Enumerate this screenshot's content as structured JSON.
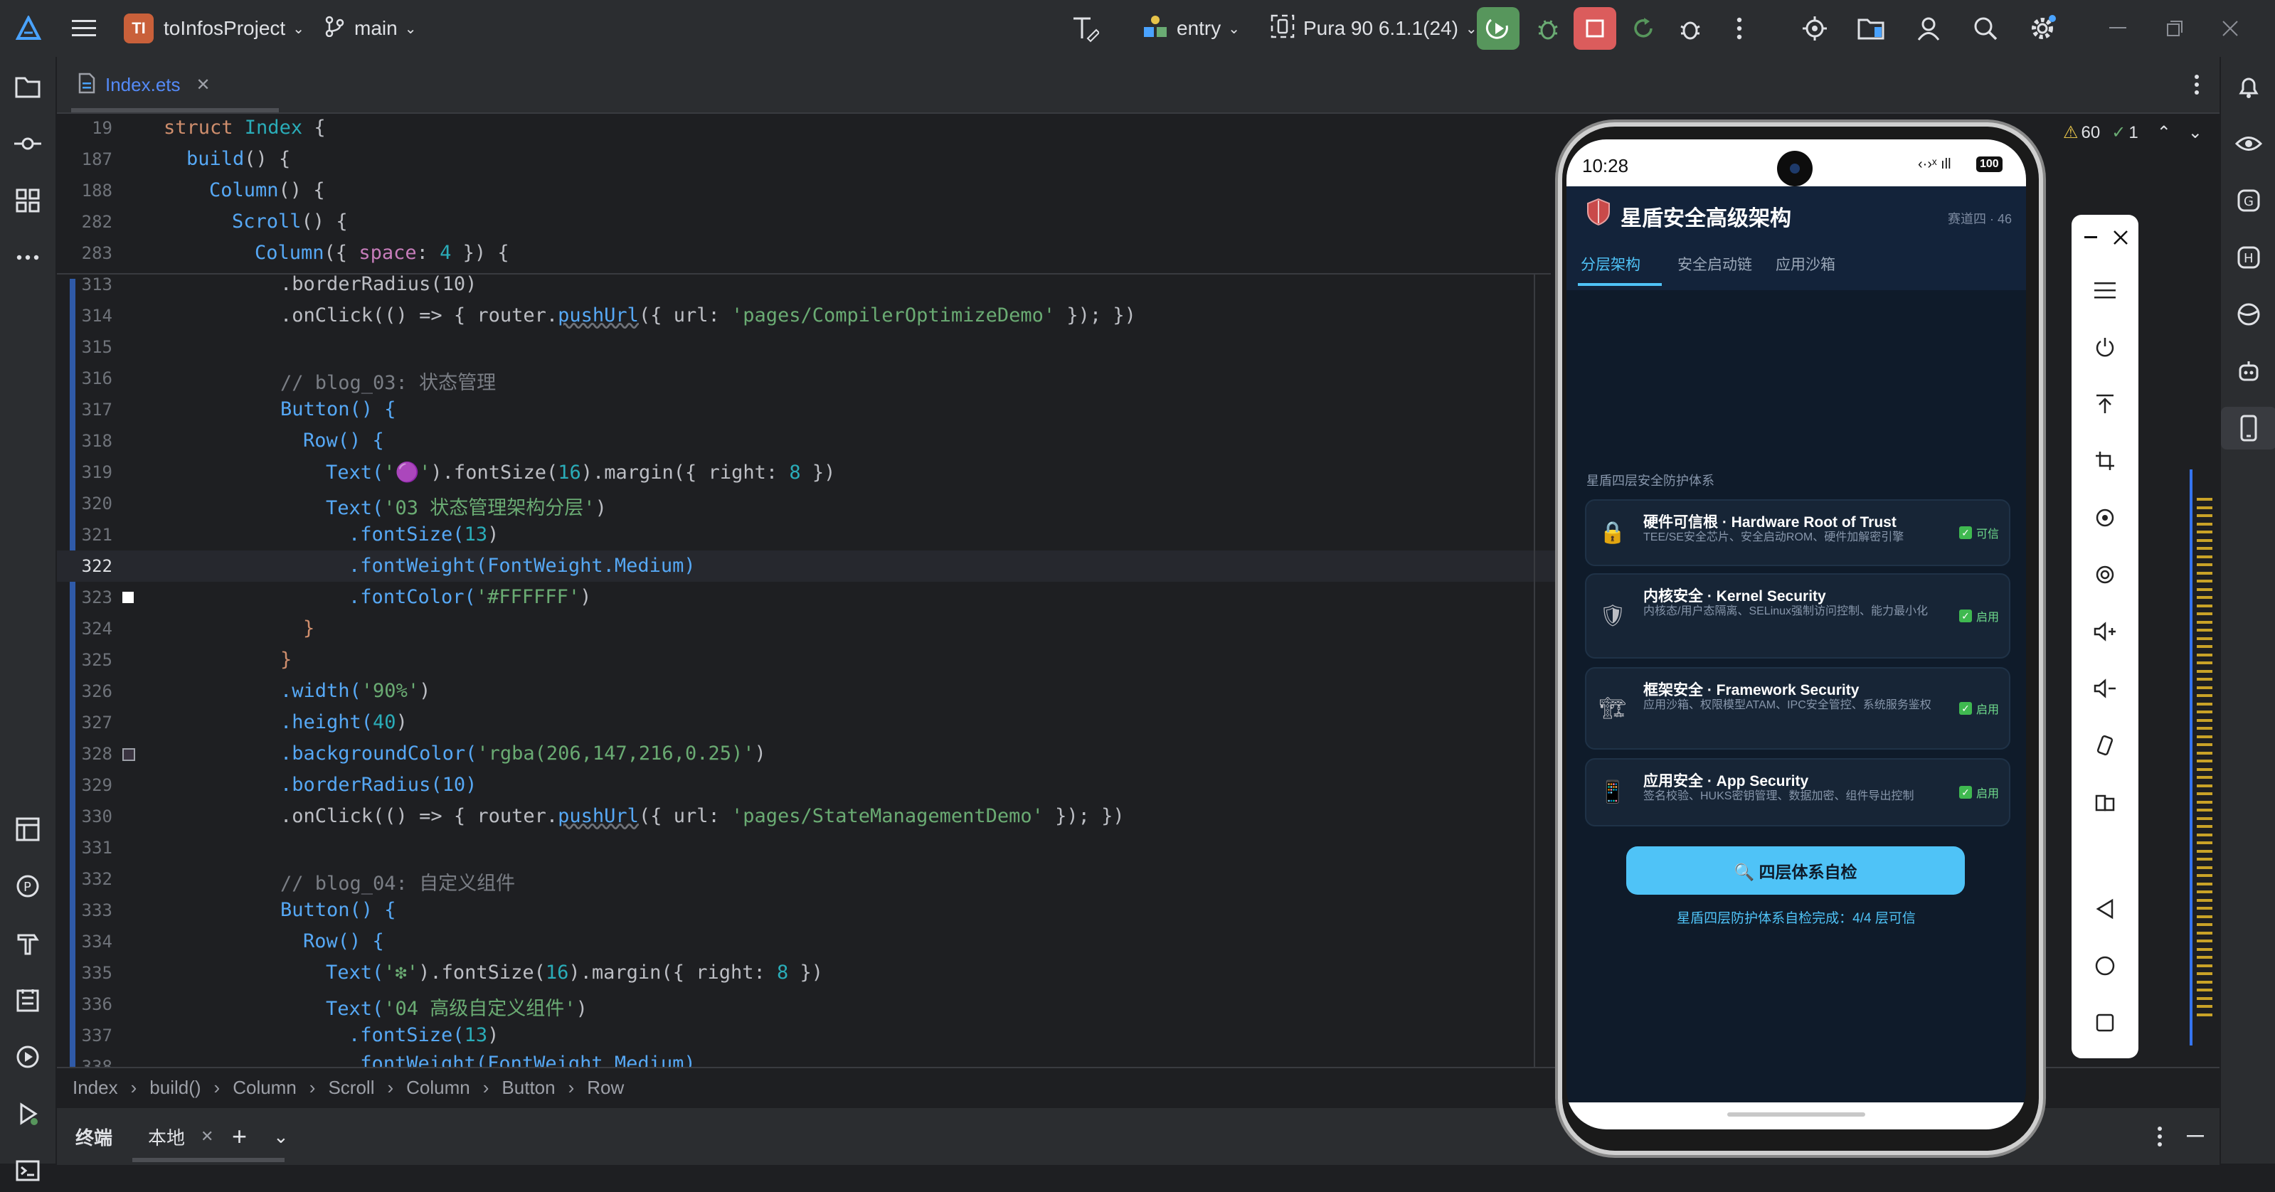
{
  "titlebar": {
    "project_badge": "TI",
    "project_name": "toInfosProject",
    "branch": "main",
    "module": "entry",
    "device": "Pura 90 6.1.1(24)"
  },
  "tab": {
    "file_name": "Index.ets"
  },
  "inspections": {
    "warnings": "60",
    "checks": "1"
  },
  "sticky": [
    {
      "ln": "19",
      "code": "struct Index {"
    },
    {
      "ln": "187",
      "code": "  build() {"
    },
    {
      "ln": "188",
      "code": "    Column() {"
    },
    {
      "ln": "282",
      "code": "      Scroll() {"
    },
    {
      "ln": "283",
      "code": "        Column({ space: 4 }) {"
    }
  ],
  "code": {
    "l313": ".borderRadius(10)",
    "l314a": ".onClick(() => { router.",
    "l314b": "pushUrl",
    "l314c": "({ url: ",
    "l314d": "'pages/CompilerOptimizeDemo'",
    "l314e": " }); })",
    "l316": "// blog_03: 状态管理",
    "l317": "Button() {",
    "l318": "Row() {",
    "l319a": "Text(",
    "l319b": "'🟣'",
    "l319c": ").fontSize(",
    "l319d": "16",
    "l319e": ").margin({ right: ",
    "l319f": "8",
    "l319g": " })",
    "l320a": "Text(",
    "l320b": "'03 状态管理架构分层'",
    "l320c": ")",
    "l321a": ".fontSize(",
    "l321b": "13",
    "l321c": ")",
    "l322": ".fontWeight(FontWeight.Medium)",
    "l323a": ".fontColor(",
    "l323b": "'#FFFFFF'",
    "l323c": ")",
    "l324": "}",
    "l325": "}",
    "l326a": ".width(",
    "l326b": "'90%'",
    "l326c": ")",
    "l327a": ".height(",
    "l327b": "40",
    "l327c": ")",
    "l328a": ".backgroundColor(",
    "l328b": "'rgba(206,147,216,0.25)'",
    "l328c": ")",
    "l329": ".borderRadius(10)",
    "l330a": ".onClick(() => { router.",
    "l330b": "pushUrl",
    "l330c": "({ url: ",
    "l330d": "'pages/StateManagementDemo'",
    "l330e": " }); })",
    "l332": "// blog_04: 自定义组件",
    "l333": "Button() {",
    "l334": "Row() {",
    "l335a": "Text(",
    "l335b": "'❇'",
    "l335c": ").fontSize(",
    "l335d": "16",
    "l335e": ").margin({ right: ",
    "l335f": "8",
    "l335g": " })",
    "l336a": "Text(",
    "l336b": "'04 高级自定义组件'",
    "l336c": ")",
    "l337a": ".fontSize(",
    "l337b": "13",
    "l337c": ")",
    "l338": ".fontWeight(FontWeight.Medium)"
  },
  "line_numbers": [
    "313",
    "314",
    "315",
    "316",
    "317",
    "318",
    "319",
    "320",
    "321",
    "322",
    "323",
    "324",
    "325",
    "326",
    "327",
    "328",
    "329",
    "330",
    "331",
    "332",
    "333",
    "334",
    "335",
    "336",
    "337",
    "338"
  ],
  "breadcrumb": [
    "Index",
    "build()",
    "Column",
    "Scroll",
    "Column",
    "Button",
    "Row"
  ],
  "bottom": {
    "terminal": "终端",
    "local": "本地"
  },
  "phone": {
    "time": "10:28",
    "battery": "100",
    "app_title": "星盾安全高级架构",
    "app_sub": "赛道四 · 46",
    "tabs": [
      "分层架构",
      "安全启动链",
      "应用沙箱"
    ],
    "section_label": "星盾四层安全防护体系",
    "layers": [
      {
        "icon": "🔒",
        "title": "硬件可信根 · Hardware Root of Trust",
        "desc": "TEE/SE安全芯片、安全启动ROM、硬件加解密引擎",
        "status": "可信"
      },
      {
        "icon": "🛡",
        "title": "内核安全 · Kernel Security",
        "desc": "内核态/用户态隔离、SELinux强制访问控制、能力最小化",
        "status": "启用"
      },
      {
        "icon": "🏗",
        "title": "框架安全 · Framework Security",
        "desc": "应用沙箱、权限模型ATAM、IPC安全管控、系统服务鉴权",
        "status": "启用"
      },
      {
        "icon": "📱",
        "title": "应用安全 · App Security",
        "desc": "签名校验、HUKS密钥管理、数据加密、组件导出控制",
        "status": "启用"
      }
    ],
    "check_button": "🔍 四层体系自检",
    "result": "星盾四层防护体系自检完成：4/4 层可信"
  }
}
